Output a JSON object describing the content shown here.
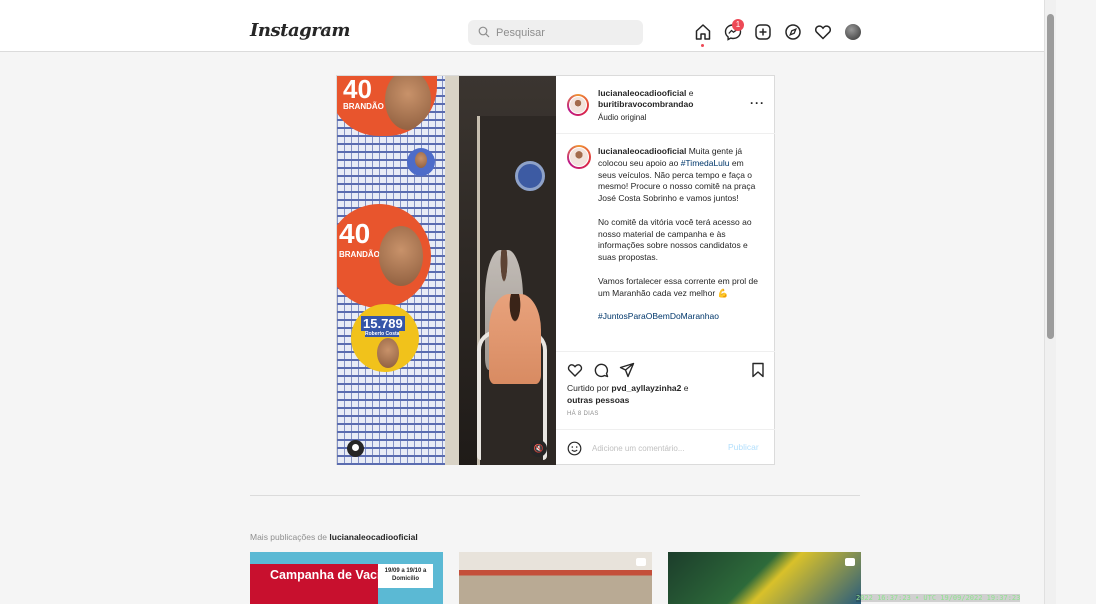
{
  "header": {
    "logo_text": "Instagram",
    "search_placeholder": "Pesquisar",
    "messages_badge": "1",
    "nav_icons": [
      "home-icon",
      "messenger-icon",
      "new-post-icon",
      "explore-icon",
      "activity-heart-icon",
      "profile-avatar"
    ]
  },
  "post": {
    "author": "lucianaleocadiooficial",
    "connector": " e ",
    "coauthor": "buritibravocombrandao",
    "audio": "Áudio original",
    "more_label": "···",
    "media": {
      "sticker_number_1": "40",
      "sticker_name": "BRANDÃO",
      "sticker_number_2": "15.789",
      "sticker_name_2": "Roberto Costa"
    },
    "caption": {
      "username": "lucianaleocadiooficial",
      "p1_before": " Muita gente já colocou seu apoio ao ",
      "p1_tag": "#TimedaLulu",
      "p1_after": " em seus veículos. Não perca tempo e faça o mesmo! Procure o nosso comitê na praça José Costa Sobrinho e vamos juntos!",
      "p2": "No comitê da vitória você terá acesso ao nosso material de campanha e às informações sobre nossos candidatos e suas propostas.",
      "p3": "Vamos fortalecer essa corrente em prol de um Maranhão cada vez melhor 💪",
      "p4_tag": "#JuntosParaOBemDoMaranhao"
    },
    "likes": {
      "prefix": "Curtido por ",
      "user": "pvd_ayllayzinha2",
      "suffix": " e",
      "others": "outras pessoas"
    },
    "age": "HÁ 8 DIAS",
    "comment_placeholder": "Adicione um comentário...",
    "publish_label": "Publicar"
  },
  "more_posts": {
    "prefix": "Mais publicações de ",
    "user": "lucianaleocadiooficial",
    "thumbs": [
      {
        "title": "Campanha de Vacinação",
        "date": "19/09 a 19/10 a Domicílio"
      },
      {
        "title": ""
      },
      {
        "title": ""
      }
    ]
  },
  "timestamp_overlay": "2022 16:37:23 • UTC 19/09/2022 19:37:23",
  "colors": {
    "accent_link": "#00376b",
    "badge": "#ed4956",
    "publish_disabled": "#b2dffc"
  }
}
